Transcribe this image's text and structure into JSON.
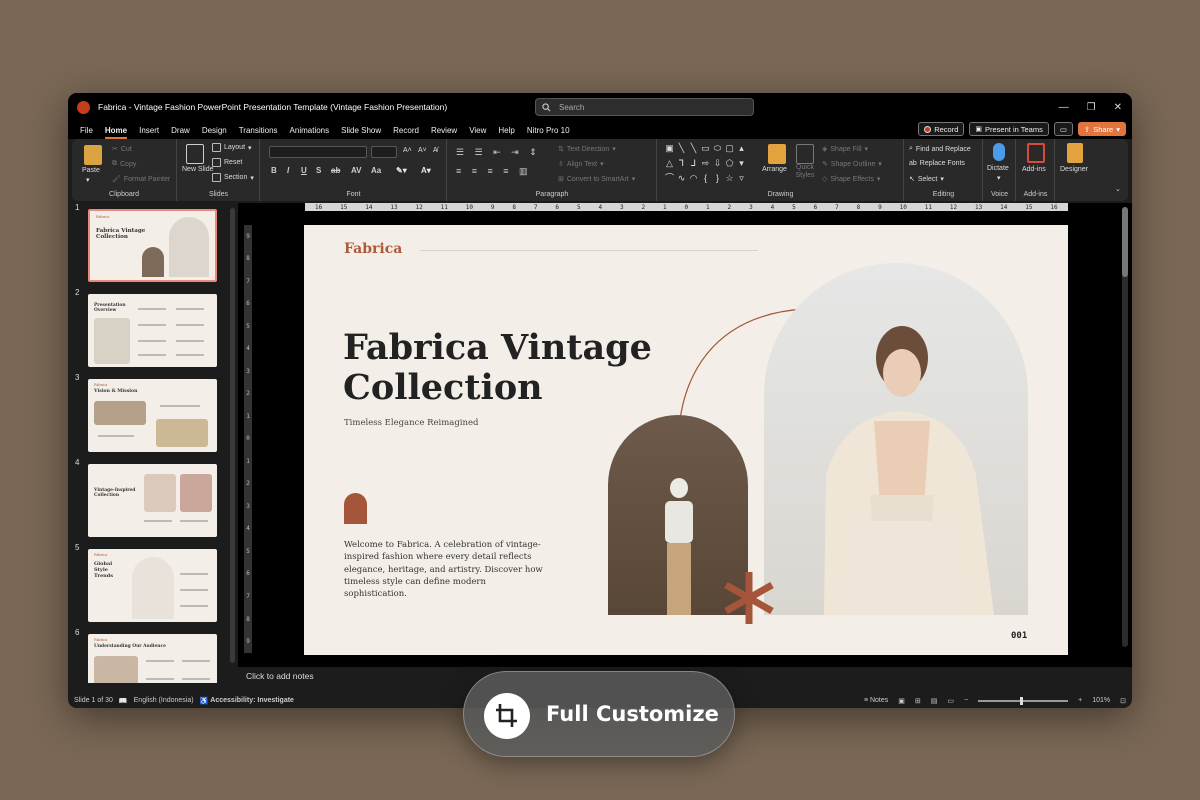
{
  "window": {
    "title": "Fabrica - Vintage Fashion PowerPoint Presentation Template (Vintage Fashion Presentation)",
    "search_placeholder": "Search"
  },
  "menu": {
    "tabs": [
      "File",
      "Home",
      "Insert",
      "Draw",
      "Design",
      "Transitions",
      "Animations",
      "Slide Show",
      "Record",
      "Review",
      "View",
      "Help",
      "Nitro Pro 10"
    ],
    "active": "Home",
    "record_label": "Record",
    "present_label": "Present in Teams",
    "share_label": "Share"
  },
  "ribbon": {
    "clipboard": {
      "label": "Clipboard",
      "paste": "Paste",
      "cut": "Cut",
      "copy": "Copy",
      "format_painter": "Format Painter"
    },
    "slides": {
      "label": "Slides",
      "new_slide": "New Slide",
      "layout": "Layout",
      "reset": "Reset",
      "section": "Section"
    },
    "font": {
      "label": "Font",
      "bold": "B",
      "italic": "I",
      "underline": "U",
      "strike": "S",
      "ab": "ab",
      "av": "AV",
      "aa": "Aa"
    },
    "paragraph": {
      "label": "Paragraph",
      "text_direction": "Text Direction",
      "align_text": "Align Text",
      "convert_smartart": "Convert to SmartArt"
    },
    "drawing": {
      "label": "Drawing",
      "arrange": "Arrange",
      "quick_styles": "Quick Styles",
      "shape_fill": "Shape Fill",
      "shape_outline": "Shape Outline",
      "shape_effects": "Shape Effects"
    },
    "editing": {
      "label": "Editing",
      "find_replace": "Find and Replace",
      "replace_fonts": "Replace Fonts",
      "select": "Select"
    },
    "voice": {
      "label": "Voice",
      "dictate": "Dictate"
    },
    "addins": {
      "label": "Add-ins",
      "addins": "Add-ins"
    },
    "designer": {
      "label": "Designer"
    }
  },
  "thumbnails": [
    {
      "num": "1",
      "title": "Fabrica Vintage Collection",
      "brand": "Fabrica"
    },
    {
      "num": "2",
      "title": "Presentation Overview"
    },
    {
      "num": "3",
      "title": "Vision & Mission",
      "brand": "Fabrica"
    },
    {
      "num": "4",
      "title": "Vintage-Inspired Collection"
    },
    {
      "num": "5",
      "title": "Global Style Trends",
      "brand": "Fabrica"
    },
    {
      "num": "6",
      "title": "Understanding Our Audience",
      "brand": "Fabrica"
    }
  ],
  "ruler": {
    "h": [
      "16",
      "15",
      "14",
      "13",
      "12",
      "11",
      "10",
      "9",
      "8",
      "7",
      "6",
      "5",
      "4",
      "3",
      "2",
      "1",
      "0",
      "1",
      "2",
      "3",
      "4",
      "5",
      "6",
      "7",
      "8",
      "9",
      "10",
      "11",
      "12",
      "13",
      "14",
      "15",
      "16"
    ],
    "v": [
      "9",
      "8",
      "7",
      "6",
      "5",
      "4",
      "3",
      "2",
      "1",
      "0",
      "1",
      "2",
      "3",
      "4",
      "5",
      "6",
      "7",
      "8",
      "9"
    ]
  },
  "slide": {
    "brand": "Fabrica",
    "title_line1": "Fabrica Vintage",
    "title_line2": "Collection",
    "subtitle": "Timeless Elegance Reimagined",
    "body": "Welcome to Fabrica. A celebration of vintage-inspired fashion where every detail reflects elegance, heritage, and artistry. Discover how timeless style can define modern sophistication.",
    "page_number": "001",
    "accent": "#a5553a"
  },
  "notes_placeholder": "Click to add notes",
  "status": {
    "slide": "Slide 1 of 30",
    "language": "English (Indonesia)",
    "accessibility": "Accessibility: Investigate",
    "notes": "Notes",
    "zoom": "101%"
  },
  "overlay": {
    "label": "Full Customize"
  }
}
